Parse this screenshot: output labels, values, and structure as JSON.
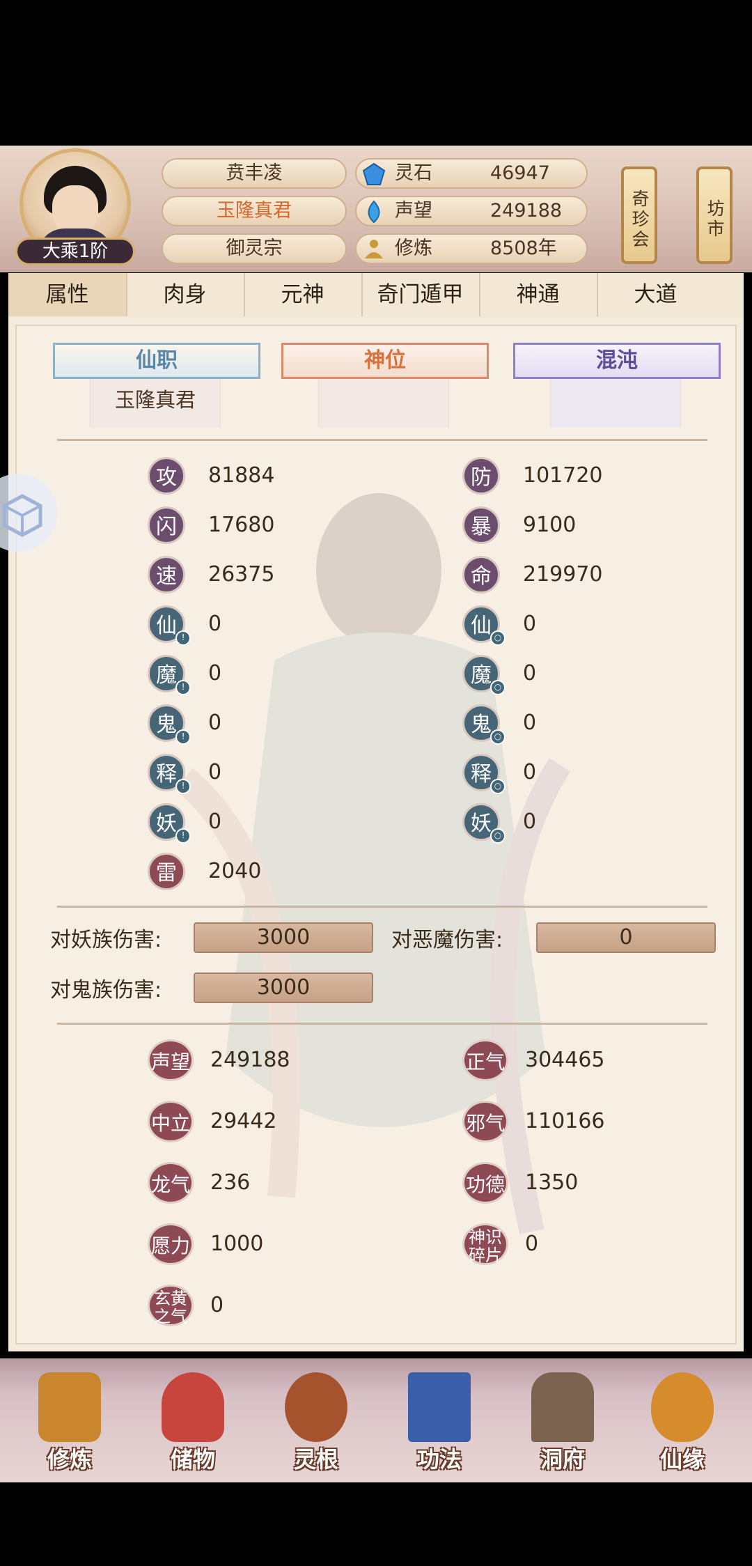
{
  "player": {
    "name": "贲丰凌",
    "title": "玉隆真君",
    "sect": "御灵宗",
    "realm": "大乘1阶"
  },
  "resources": [
    {
      "label": "灵石",
      "value": "46947",
      "icon": "spirit-stone-icon",
      "color": "#3a8fe0"
    },
    {
      "label": "声望",
      "value": "249188",
      "icon": "reputation-icon",
      "color": "#3aa0e8"
    },
    {
      "label": "修炼",
      "value": "8508年",
      "icon": "meditation-icon",
      "color": "#c79a3a"
    }
  ],
  "side_buttons": [
    "奇珍会",
    "坊市"
  ],
  "tabs": [
    "属性",
    "肉身",
    "元神",
    "奇门遁甲",
    "神通",
    "大道"
  ],
  "banners": [
    {
      "label": "仙职",
      "value": "玉隆真君"
    },
    {
      "label": "神位",
      "value": ""
    },
    {
      "label": "混沌",
      "value": ""
    }
  ],
  "stats_left": [
    {
      "char": "攻",
      "value": "81884"
    },
    {
      "char": "闪",
      "value": "17680"
    },
    {
      "char": "速",
      "value": "26375"
    },
    {
      "char": "仙",
      "value": "0"
    },
    {
      "char": "魔",
      "value": "0"
    },
    {
      "char": "鬼",
      "value": "0"
    },
    {
      "char": "释",
      "value": "0"
    },
    {
      "char": "妖",
      "value": "0"
    },
    {
      "char": "雷",
      "value": "2040"
    }
  ],
  "stats_right": [
    {
      "char": "防",
      "value": "101720"
    },
    {
      "char": "暴",
      "value": "9100"
    },
    {
      "char": "命",
      "value": "219970"
    },
    {
      "char": "仙",
      "value": "0"
    },
    {
      "char": "魔",
      "value": "0"
    },
    {
      "char": "鬼",
      "value": "0"
    },
    {
      "char": "释",
      "value": "0"
    },
    {
      "char": "妖",
      "value": "0"
    }
  ],
  "damage": [
    {
      "label": "对妖族伤害:",
      "value": "3000"
    },
    {
      "label": "对恶魔伤害:",
      "value": "0"
    },
    {
      "label": "对鬼族伤害:",
      "value": "3000"
    }
  ],
  "extras_left": [
    {
      "label": "声望",
      "value": "249188"
    },
    {
      "label": "中立",
      "value": "29442"
    },
    {
      "label": "龙气",
      "value": "236"
    },
    {
      "label": "愿力",
      "value": "1000"
    },
    {
      "label": "玄黄之气",
      "value": "0"
    }
  ],
  "extras_right": [
    {
      "label": "正气",
      "value": "304465"
    },
    {
      "label": "邪气",
      "value": "110166"
    },
    {
      "label": "功德",
      "value": "1350"
    },
    {
      "label": "神识碎片",
      "value": "0"
    }
  ],
  "bottom_nav": [
    {
      "label": "修炼",
      "icon": "cultivate-icon",
      "color": "#c9862f"
    },
    {
      "label": "储物",
      "icon": "bag-icon",
      "color": "#c8453e"
    },
    {
      "label": "灵根",
      "icon": "spirit-root-icon",
      "color": "#a5532c"
    },
    {
      "label": "功法",
      "icon": "book-icon",
      "color": "#3a5fa8"
    },
    {
      "label": "洞府",
      "icon": "mansion-icon",
      "color": "#7a6450"
    },
    {
      "label": "仙缘",
      "icon": "gourd-icon",
      "color": "#d68b2c"
    }
  ]
}
